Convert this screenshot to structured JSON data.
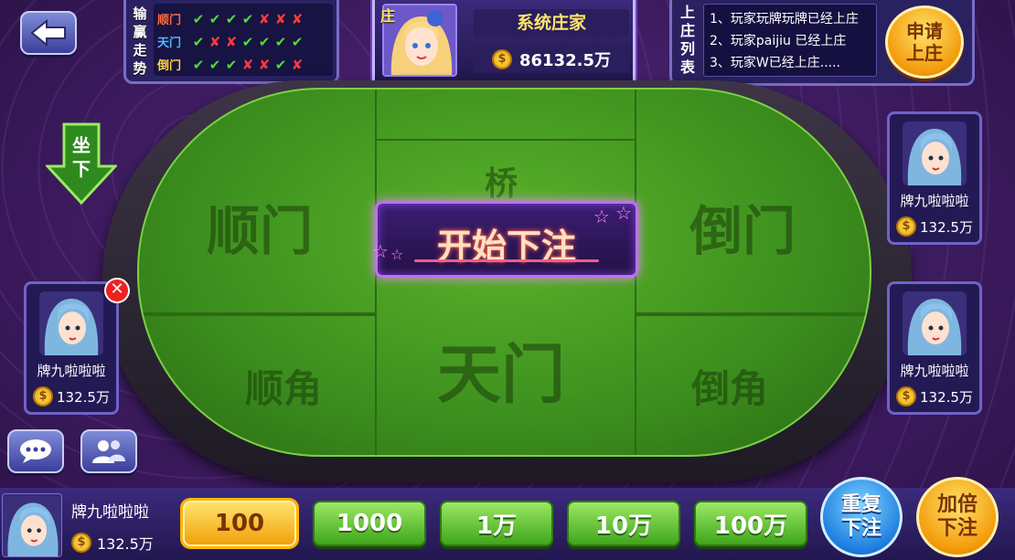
{
  "trend": {
    "title": [
      "输",
      "赢",
      "走",
      "势"
    ],
    "rows": [
      {
        "label": "顺门",
        "marks": [
          "ok",
          "ok",
          "ok",
          "ok",
          "ng",
          "ng",
          "ng"
        ]
      },
      {
        "label": "天门",
        "marks": [
          "ok",
          "ng",
          "ng",
          "ok",
          "ok",
          "ok",
          "ok"
        ]
      },
      {
        "label": "倒门",
        "marks": [
          "ok",
          "ok",
          "ok",
          "ng",
          "ng",
          "ok",
          "ng"
        ]
      }
    ],
    "ok_symbol": "✔",
    "ng_symbol": "✘"
  },
  "banker": {
    "tag": "庄",
    "name": "系统庄家",
    "money": "86132.5万"
  },
  "banker_list": {
    "title": [
      "上",
      "庄",
      "列",
      "表"
    ],
    "items": [
      "1、玩家玩牌玩牌已经上庄",
      "2、玩家paijiu 已经上庄",
      "3、玩家W已经上庄....."
    ],
    "apply_label": "申请上庄"
  },
  "sit_label": "坐下",
  "table": {
    "zones": {
      "shunmen": "顺门",
      "qiao": "桥",
      "daomen": "倒门",
      "shunjiao": "顺角",
      "tianmen": "天门",
      "daojiao": "倒角"
    },
    "banner": "开始下注"
  },
  "seats": {
    "left": {
      "name": "牌九啦啦啦",
      "money": "132.5万"
    },
    "right_top": {
      "name": "牌九啦啦啦",
      "money": "132.5万"
    },
    "right_bottom": {
      "name": "牌九啦啦啦",
      "money": "132.5万"
    }
  },
  "me": {
    "name": "牌九啦啦啦",
    "money": "132.5万"
  },
  "chips": [
    "100",
    "1000",
    "1万",
    "10万",
    "100万"
  ],
  "selected_chip": "100",
  "repeat_label": "重复下注",
  "double_label": "加倍下注",
  "colors": {
    "felt": "#3c8f1e",
    "panel": "#2a2161",
    "gold": "#f39b0a",
    "ok": "#4ddb3a",
    "ng": "#ff3b3b"
  }
}
